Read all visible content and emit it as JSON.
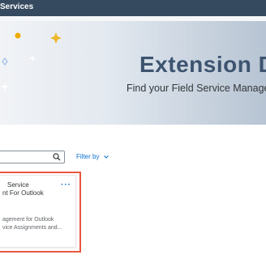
{
  "topbar": {
    "title": "Services"
  },
  "hero": {
    "title": "Extension Dir",
    "subtitle": "Find your Field Service Managem"
  },
  "toolbar": {
    "search_placeholder": "",
    "filter_label": "Filter by"
  },
  "card": {
    "title_line1": "Service",
    "title_line2": "nt For Outlook",
    "menu_label": "···",
    "desc_line1": "agement for Outlook",
    "desc_line2": "vice Assignments and..."
  },
  "colors": {
    "topbar": "#354a5f",
    "accent": "#0a6ed1",
    "highlight_border": "#e9573f"
  },
  "icons": [
    "search-icon",
    "chevron-down-icon",
    "overflow-menu-icon",
    "sparkle-icon"
  ]
}
